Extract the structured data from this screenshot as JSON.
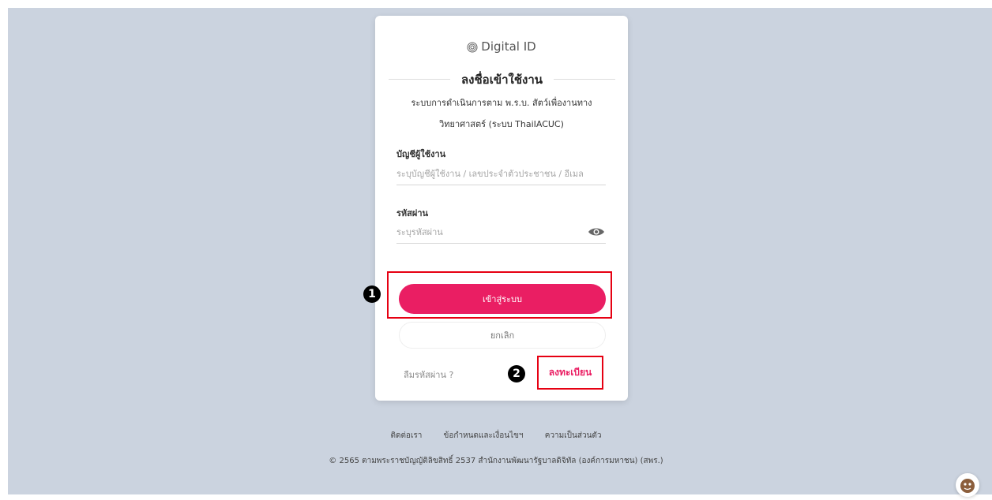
{
  "brand": {
    "name": "Digital ID",
    "icon": "fingerprint-icon"
  },
  "login": {
    "title": "ลงชื่อเข้าใช้งาน",
    "subtitle_line1": "ระบบการดำเนินการตาม พ.ร.บ. สัตว์เพื่องานทาง",
    "subtitle_line2": "วิทยาศาสตร์ (ระบบ ThaiIACUC)",
    "username_label": "บัญชีผู้ใช้งาน",
    "username_placeholder": "ระบุบัญชีผู้ใช้งาน / เลขประจำตัวประชาชน / อีเมล",
    "password_label": "รหัสผ่าน",
    "password_placeholder": "ระบุรหัสผ่าน",
    "login_button": "เข้าสู่ระบบ",
    "cancel_button": "ยกเลิก",
    "forgot_password": "ลืมรหัสผ่าน ?",
    "register": "ลงทะเบียน"
  },
  "annotations": {
    "marker1": "1",
    "marker2": "2",
    "highlight_color": "#e60012"
  },
  "footer": {
    "links": [
      "ติดต่อเรา",
      "ข้อกำหนดและเงื่อนไขฯ",
      "ความเป็นส่วนตัว"
    ],
    "copyright": "© 2565 ตามพระราชบัญญัติลิขสิทธิ์ 2537 สำนักงานพัฒนารัฐบาลดิจิทัล (องค์การมหาชน) (สพร.)"
  },
  "colors": {
    "accent": "#ea1e63",
    "background": "#cbd3df"
  }
}
